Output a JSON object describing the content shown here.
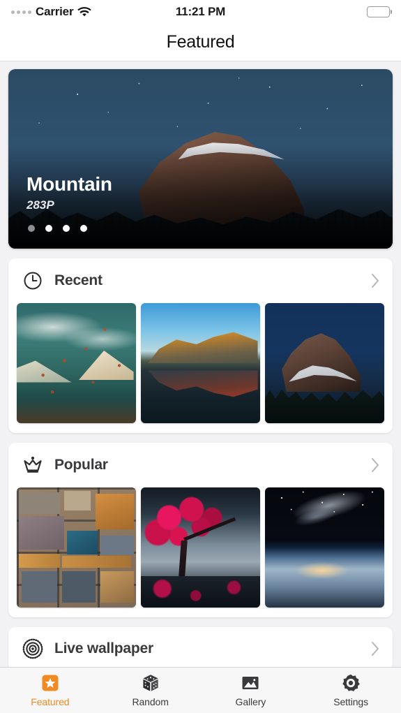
{
  "status_bar": {
    "signal_icon": "signal-dots-icon",
    "carrier": "Carrier",
    "wifi_icon": "wifi-icon",
    "time": "11:21 PM",
    "battery_icon": "battery-full-icon"
  },
  "navbar": {
    "title": "Featured"
  },
  "hero": {
    "image_alt": "half-dome-night-sky",
    "title": "Mountain",
    "subtitle": "283P",
    "pager": {
      "total": 4,
      "active_index": 0
    }
  },
  "sections": [
    {
      "id": "recent",
      "icon": "clock-icon",
      "title": "Recent",
      "disclosure_icon": "chevron-right-icon",
      "thumbnails": [
        {
          "name": "painted-teal-mountains",
          "alt": "Teal painted mountain landscape"
        },
        {
          "name": "lake-reflection-sunrise",
          "alt": "Golden mountains reflected in lake"
        },
        {
          "name": "half-dome-dark",
          "alt": "Half Dome against dark blue sky"
        }
      ]
    },
    {
      "id": "popular",
      "icon": "crown-icon",
      "title": "Popular",
      "disclosure_icon": "chevron-right-icon",
      "thumbnails": [
        {
          "name": "colored-stone-wall",
          "alt": "Colorful stacked stone wall"
        },
        {
          "name": "crimson-tree",
          "alt": "Crimson tree on blue-gray ground"
        },
        {
          "name": "earth-from-space",
          "alt": "Earth horizon with Milky Way"
        }
      ]
    },
    {
      "id": "live-wallpaper",
      "icon": "radial-ripple-icon",
      "title": "Live wallpaper",
      "disclosure_icon": "chevron-right-icon",
      "thumbnails": []
    }
  ],
  "tabbar": {
    "items": [
      {
        "id": "featured",
        "icon": "star-badge-icon",
        "label": "Featured",
        "active": true
      },
      {
        "id": "random",
        "icon": "dice-icon",
        "label": "Random",
        "active": false
      },
      {
        "id": "gallery",
        "icon": "photo-icon",
        "label": "Gallery",
        "active": false
      },
      {
        "id": "settings",
        "icon": "gear-icon",
        "label": "Settings",
        "active": false
      }
    ]
  },
  "colors": {
    "accent": "#f08a22",
    "background": "#f2f2f4",
    "card": "#ffffff",
    "text_primary": "#111111",
    "text_secondary": "#3a3a3c",
    "chevron": "#b5b5ba"
  }
}
